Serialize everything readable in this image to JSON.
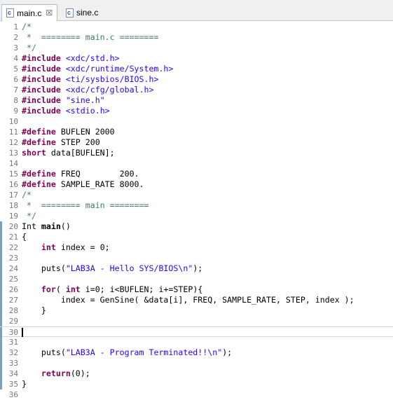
{
  "tabs": [
    {
      "label": "main.c",
      "active": true,
      "icon": "c-file-icon"
    },
    {
      "label": "sine.c",
      "active": false,
      "icon": "c-file-icon"
    }
  ],
  "tab_close_glyph": "☒",
  "colors": {
    "keyword": "#7f0055",
    "string": "#2a00ff",
    "comment": "#3f7f5f",
    "line_number": "#787878",
    "change_marker": "#7f9fbf"
  },
  "code_lines": [
    {
      "n": "1",
      "segs": [
        [
          "cm",
          "/*"
        ]
      ]
    },
    {
      "n": "2",
      "segs": [
        [
          "cm",
          " *  ======== main.c ========"
        ]
      ]
    },
    {
      "n": "3",
      "segs": [
        [
          "cm",
          " */"
        ]
      ]
    },
    {
      "n": "4",
      "segs": [
        [
          "kw",
          "#include"
        ],
        [
          "pl",
          " "
        ],
        [
          "str",
          "<xdc/std.h>"
        ]
      ]
    },
    {
      "n": "5",
      "segs": [
        [
          "kw",
          "#include"
        ],
        [
          "pl",
          " "
        ],
        [
          "str",
          "<xdc/runtime/System.h>"
        ]
      ]
    },
    {
      "n": "6",
      "segs": [
        [
          "kw",
          "#include"
        ],
        [
          "pl",
          " "
        ],
        [
          "str",
          "<ti/sysbios/BIOS.h>"
        ]
      ]
    },
    {
      "n": "7",
      "segs": [
        [
          "kw",
          "#include"
        ],
        [
          "pl",
          " "
        ],
        [
          "str",
          "<xdc/cfg/global.h>"
        ]
      ]
    },
    {
      "n": "8",
      "segs": [
        [
          "kw",
          "#include"
        ],
        [
          "pl",
          " "
        ],
        [
          "str",
          "\"sine.h\""
        ]
      ]
    },
    {
      "n": "9",
      "segs": [
        [
          "kw",
          "#include"
        ],
        [
          "pl",
          " "
        ],
        [
          "str",
          "<stdio.h>"
        ]
      ]
    },
    {
      "n": "10",
      "segs": []
    },
    {
      "n": "11",
      "segs": [
        [
          "kw",
          "#define"
        ],
        [
          "pl",
          " BUFLEN 2000"
        ]
      ]
    },
    {
      "n": "12",
      "segs": [
        [
          "kw",
          "#define"
        ],
        [
          "pl",
          " STEP 200"
        ]
      ]
    },
    {
      "n": "13",
      "segs": [
        [
          "kw",
          "short"
        ],
        [
          "pl",
          " data[BUFLEN];"
        ]
      ]
    },
    {
      "n": "14",
      "segs": []
    },
    {
      "n": "15",
      "segs": [
        [
          "kw",
          "#define"
        ],
        [
          "pl",
          " FREQ        200."
        ]
      ]
    },
    {
      "n": "16",
      "segs": [
        [
          "kw",
          "#define"
        ],
        [
          "pl",
          " SAMPLE_RATE 8000."
        ]
      ]
    },
    {
      "n": "17",
      "segs": [
        [
          "cm",
          "/*"
        ]
      ]
    },
    {
      "n": "18",
      "segs": [
        [
          "cm",
          " *  ======== main ========"
        ]
      ]
    },
    {
      "n": "19",
      "segs": [
        [
          "cm",
          " */"
        ]
      ]
    },
    {
      "n": "20",
      "segs": [
        [
          "pl",
          "Int "
        ],
        [
          "b",
          "main"
        ],
        [
          "pl",
          "()"
        ]
      ],
      "mark": true
    },
    {
      "n": "21",
      "segs": [
        [
          "pl",
          "{"
        ]
      ],
      "mark": true
    },
    {
      "n": "22",
      "segs": [
        [
          "pl",
          "    "
        ],
        [
          "kw",
          "int"
        ],
        [
          "pl",
          " index = 0;"
        ]
      ],
      "mark": true
    },
    {
      "n": "23",
      "segs": [],
      "mark": true
    },
    {
      "n": "24",
      "segs": [
        [
          "pl",
          "    puts("
        ],
        [
          "str",
          "\"LAB3A - Hello SYS/BIOS\\n\""
        ],
        [
          "pl",
          ");"
        ]
      ],
      "mark": true
    },
    {
      "n": "25",
      "segs": [],
      "mark": true
    },
    {
      "n": "26",
      "segs": [
        [
          "pl",
          "    "
        ],
        [
          "kw",
          "for"
        ],
        [
          "pl",
          "( "
        ],
        [
          "kw",
          "int"
        ],
        [
          "pl",
          " i=0; i<BUFLEN; i+=STEP){"
        ]
      ],
      "mark": true
    },
    {
      "n": "27",
      "segs": [
        [
          "pl",
          "        index = GenSine( &data[i], FREQ, SAMPLE_RATE, STEP, index );"
        ]
      ],
      "mark": true
    },
    {
      "n": "28",
      "segs": [
        [
          "pl",
          "    }"
        ]
      ],
      "mark": true
    },
    {
      "n": "29",
      "segs": [],
      "mark": true
    },
    {
      "n": "30",
      "segs": [],
      "mark": true,
      "current": true
    },
    {
      "n": "31",
      "segs": [],
      "mark": true
    },
    {
      "n": "32",
      "segs": [
        [
          "pl",
          "    puts("
        ],
        [
          "str",
          "\"LAB3A - Program Terminated!!\\n\""
        ],
        [
          "pl",
          ");"
        ]
      ],
      "mark": true
    },
    {
      "n": "33",
      "segs": [],
      "mark": true
    },
    {
      "n": "34",
      "segs": [
        [
          "pl",
          "    "
        ],
        [
          "kw",
          "return"
        ],
        [
          "pl",
          "(0);"
        ]
      ],
      "mark": true
    },
    {
      "n": "35",
      "segs": [
        [
          "pl",
          "}"
        ]
      ],
      "mark": true
    },
    {
      "n": "36",
      "segs": []
    }
  ]
}
